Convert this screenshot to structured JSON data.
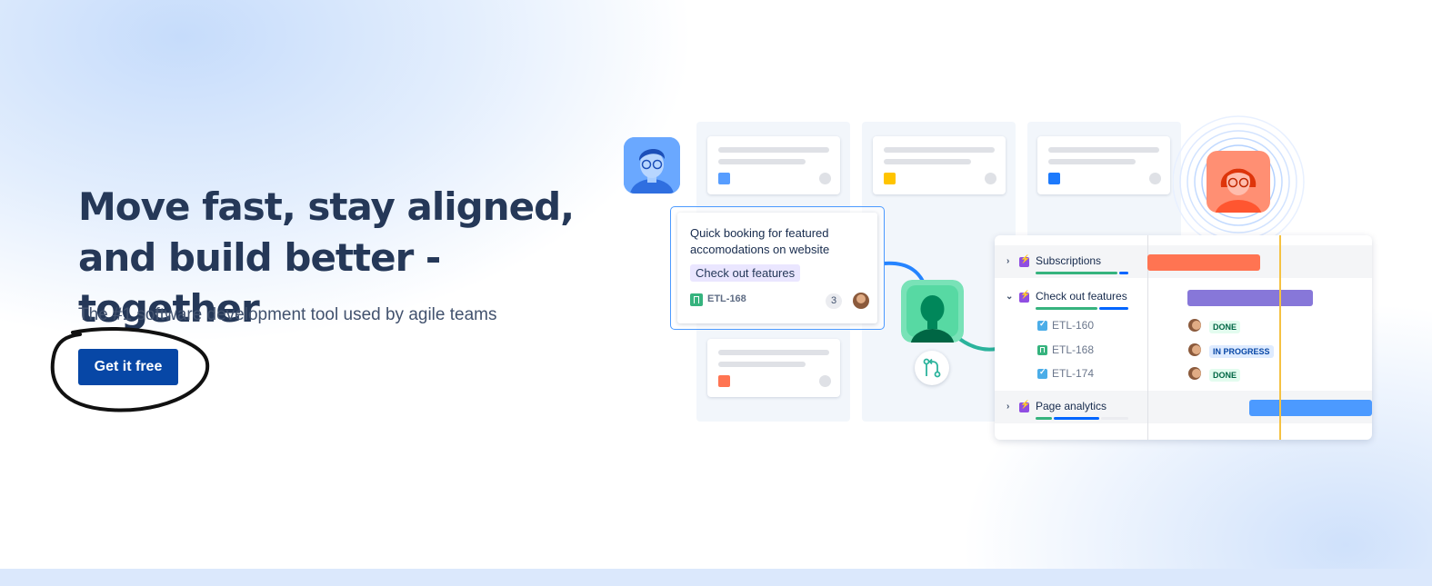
{
  "hero": {
    "title_line1": "Move fast, stay aligned,",
    "title_line2": "and build better - together",
    "subtitle": "The #1 software development tool used by agile teams",
    "cta_label": "Get it free"
  },
  "board": {
    "card": {
      "title": "Quick booking for featured accomodations on website",
      "tag": "Check out features",
      "key": "ETL-168",
      "count": "3"
    },
    "mini_card_colors": [
      "#579dff",
      "#ffc400",
      "#1d7afc",
      "#ff7452"
    ]
  },
  "timeline": {
    "rows": [
      {
        "label": "Subscriptions",
        "type": "epic",
        "expanded": false
      },
      {
        "label": "Check out features",
        "type": "epic",
        "expanded": true
      },
      {
        "label": "Page analytics",
        "type": "epic",
        "expanded": false
      }
    ],
    "subtasks": [
      {
        "key": "ETL-160",
        "status": "DONE",
        "icon": "task-icon"
      },
      {
        "key": "ETL-168",
        "status": "IN PROGRESS",
        "icon": "story-icon"
      },
      {
        "key": "ETL-174",
        "status": "DONE",
        "icon": "task-icon"
      }
    ],
    "colors": {
      "orange": "#ff7452",
      "purple": "#8777d9",
      "blue": "#4c9aff",
      "today": "#f5c242"
    }
  },
  "colors": {
    "title": "#253858",
    "cta_bg": "#0747a6",
    "subtitle": "#42526e"
  }
}
